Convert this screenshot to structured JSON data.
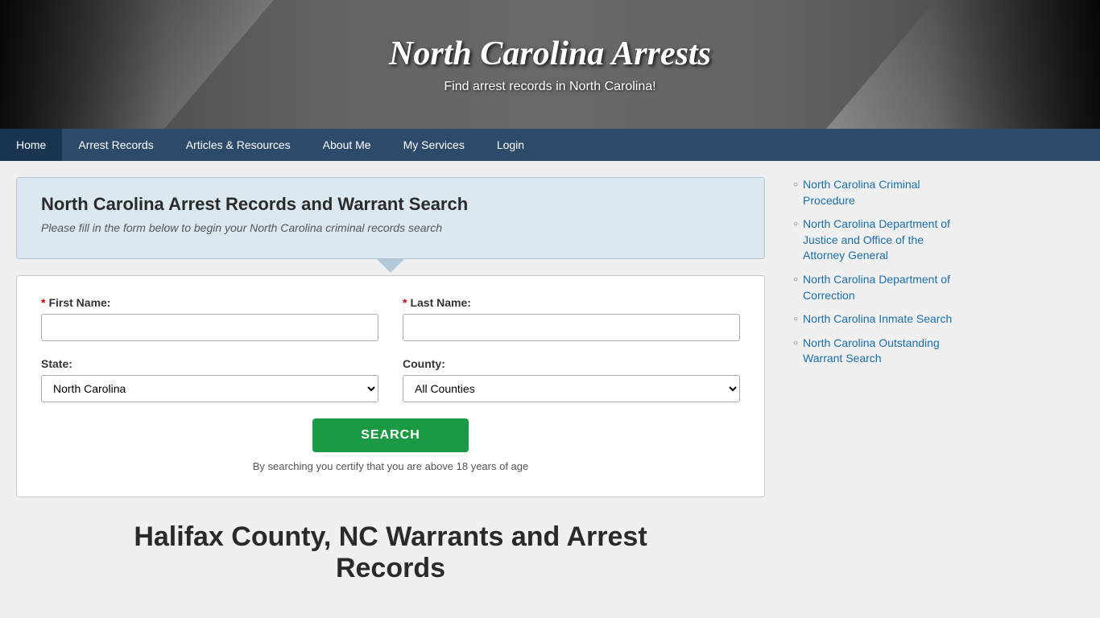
{
  "header": {
    "title": "North Carolina Arrests",
    "subtitle": "Find arrest records in North Carolina!"
  },
  "nav": {
    "items": [
      {
        "label": "Home",
        "active": false
      },
      {
        "label": "Arrest Records",
        "active": false
      },
      {
        "label": "Articles & Resources",
        "active": false
      },
      {
        "label": "About Me",
        "active": false
      },
      {
        "label": "My Services",
        "active": false
      },
      {
        "label": "Login",
        "active": false
      }
    ]
  },
  "search_section": {
    "title": "North Carolina Arrest Records and Warrant Search",
    "subtitle": "Please fill in the form below to begin your North Carolina criminal records search",
    "first_name_label": "First Name:",
    "last_name_label": "Last Name:",
    "state_label": "State:",
    "county_label": "County:",
    "state_value": "North Carolina",
    "county_value": "All Counties",
    "search_button": "SEARCH",
    "disclaimer": "By searching you certify that you are above 18 years of age"
  },
  "page_heading": {
    "line1": "Halifax County, NC Warrants and Arrest",
    "line2": "Records"
  },
  "sidebar": {
    "links": [
      {
        "text": "North Carolina Criminal Procedure"
      },
      {
        "text": "North Carolina Department of Justice and Office of the Attorney General"
      },
      {
        "text": "North Carolina Department of Correction"
      },
      {
        "text": "North Carolina Inmate Search"
      },
      {
        "text": "North Carolina Outstanding Warrant Search"
      }
    ]
  }
}
